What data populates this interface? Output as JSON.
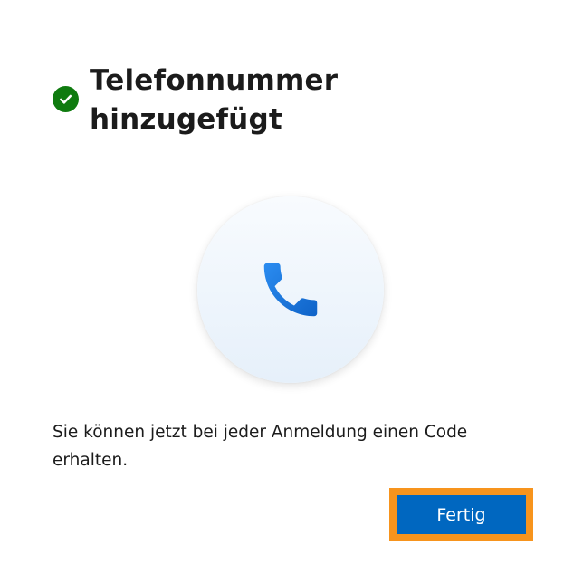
{
  "dialog": {
    "title": "Telefonnummer hinzugefügt",
    "status_icon": "checkmark-circle-icon",
    "illustration_icon": "phone-icon",
    "message": "Sie können jetzt bei jeder Anmeldung einen Code erhalten.",
    "primary_button_label": "Fertig"
  },
  "colors": {
    "accent": "#0067c0",
    "success": "#0f7b0f",
    "focus_ring": "#f7941d",
    "phone_icon": "#1a7fe0"
  }
}
